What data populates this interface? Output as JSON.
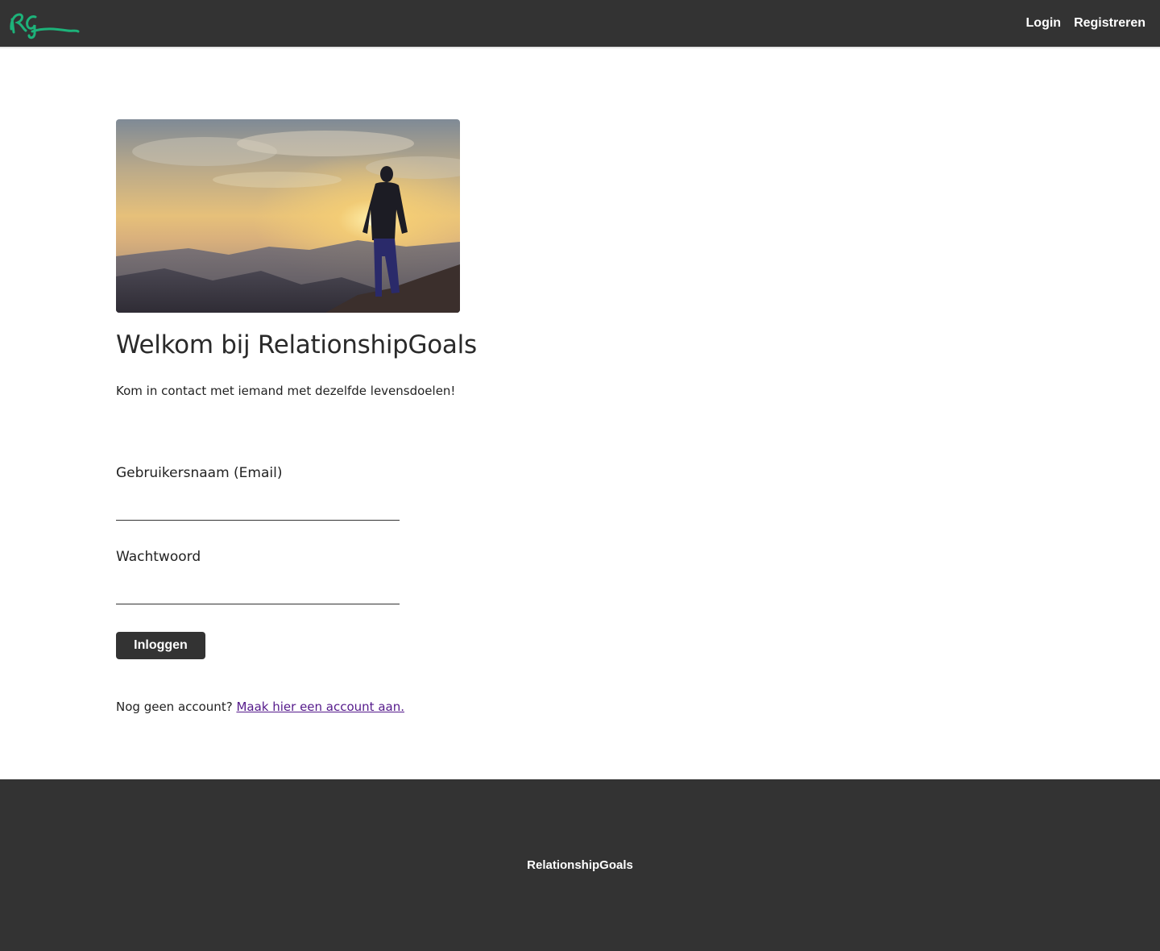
{
  "nav": {
    "logo_text": "RG",
    "login_label": "Login",
    "register_label": "Registreren"
  },
  "hero": {
    "title": "Welkom bij RelationshipGoals",
    "subtitle": "Kom in contact met iemand met dezelfde levensdoelen!"
  },
  "form": {
    "username_label": "Gebruikersnaam (Email)",
    "username_value": "",
    "password_label": "Wachtwoord",
    "password_value": "",
    "submit_label": "Inloggen"
  },
  "signup": {
    "prompt": "Nog geen account?",
    "link_label": "Maak hier een account aan."
  },
  "footer": {
    "brand": "RelationshipGoals"
  },
  "colors": {
    "nav_bg": "#333333",
    "logo_green": "#1db37a",
    "link_visited": "#551a8b"
  }
}
